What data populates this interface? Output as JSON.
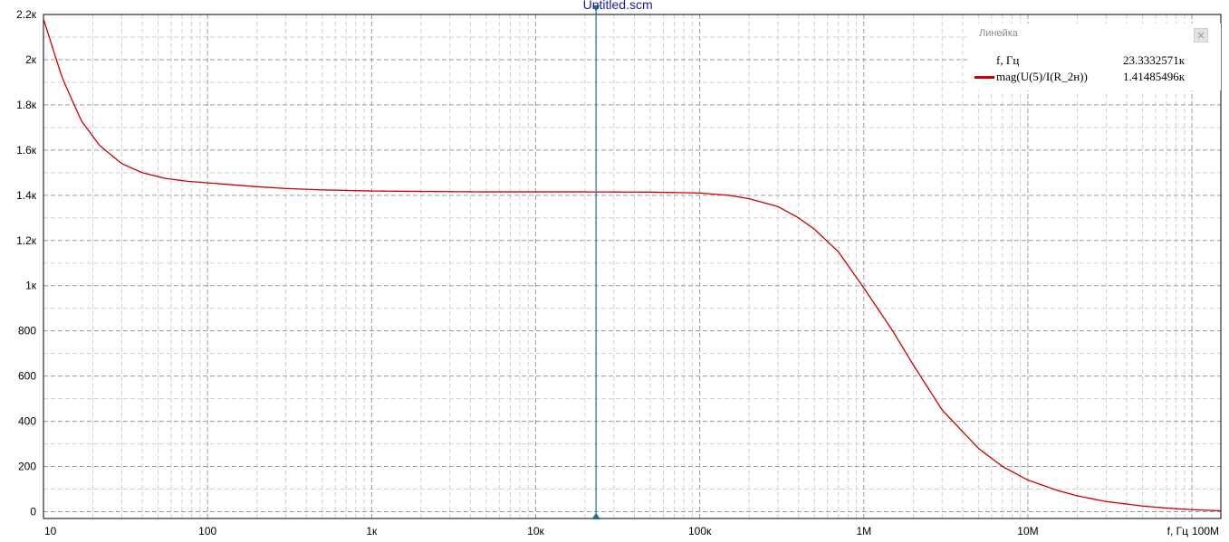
{
  "window": {
    "title": "Untitled.scm"
  },
  "ruler_panel": {
    "title": "Линейка",
    "close_icon": "close-icon",
    "rows": [
      {
        "name": "f, Гц",
        "value": "23.3332571к",
        "color": ""
      },
      {
        "name": "mag(U(5)/I(R_2н))",
        "value": "1.41485496к",
        "color": "#cc0000"
      }
    ]
  },
  "chart_data": {
    "type": "line",
    "title": "Untitled.scm",
    "xlabel": "f, Гц",
    "ylabel": "",
    "xscale": "log",
    "xlim": [
      10,
      150000000
    ],
    "ylim": [
      -30,
      2200
    ],
    "grid": true,
    "x_tick_labels": [
      {
        "x": 10,
        "label": "10"
      },
      {
        "x": 100,
        "label": "100"
      },
      {
        "x": 1000,
        "label": "1к"
      },
      {
        "x": 10000,
        "label": "10к"
      },
      {
        "x": 100000,
        "label": "100к"
      },
      {
        "x": 1000000,
        "label": "1М"
      },
      {
        "x": 10000000,
        "label": "10М"
      },
      {
        "x": 100000000,
        "label": "100М"
      }
    ],
    "y_tick_labels": [
      {
        "y": 0,
        "label": "0"
      },
      {
        "y": 200,
        "label": "200"
      },
      {
        "y": 400,
        "label": "400"
      },
      {
        "y": 600,
        "label": "600"
      },
      {
        "y": 800,
        "label": "800"
      },
      {
        "y": 1000,
        "label": "1к"
      },
      {
        "y": 1200,
        "label": "1.2к"
      },
      {
        "y": 1400,
        "label": "1.4к"
      },
      {
        "y": 1600,
        "label": "1.6к"
      },
      {
        "y": 1800,
        "label": "1.8к"
      },
      {
        "y": 2000,
        "label": "2к"
      },
      {
        "y": 2200,
        "label": "2.2к"
      }
    ],
    "cursor": {
      "x": 23333.2571,
      "color": "#1f6f86"
    },
    "series": [
      {
        "name": "mag(U(5)/I(R_2н))",
        "color": "#cc0000",
        "x": [
          10,
          13,
          17,
          22,
          30,
          40,
          55,
          75,
          100,
          150,
          200,
          300,
          500,
          1000,
          2000,
          5000,
          10000,
          20000,
          50000,
          100000,
          150000,
          200000,
          300000,
          400000,
          500000,
          700000,
          1000000,
          1500000,
          2000000,
          3000000,
          5000000,
          7000000,
          10000000,
          15000000,
          20000000,
          30000000,
          50000000,
          70000000,
          100000000,
          150000000
        ],
        "y": [
          2180,
          1920,
          1730,
          1620,
          1540,
          1500,
          1475,
          1462,
          1455,
          1445,
          1438,
          1430,
          1424,
          1419,
          1417,
          1415,
          1415,
          1415,
          1414,
          1410,
          1400,
          1385,
          1350,
          1300,
          1250,
          1150,
          990,
          800,
          650,
          450,
          280,
          200,
          140,
          95,
          70,
          45,
          25,
          16,
          9,
          4
        ]
      }
    ]
  }
}
